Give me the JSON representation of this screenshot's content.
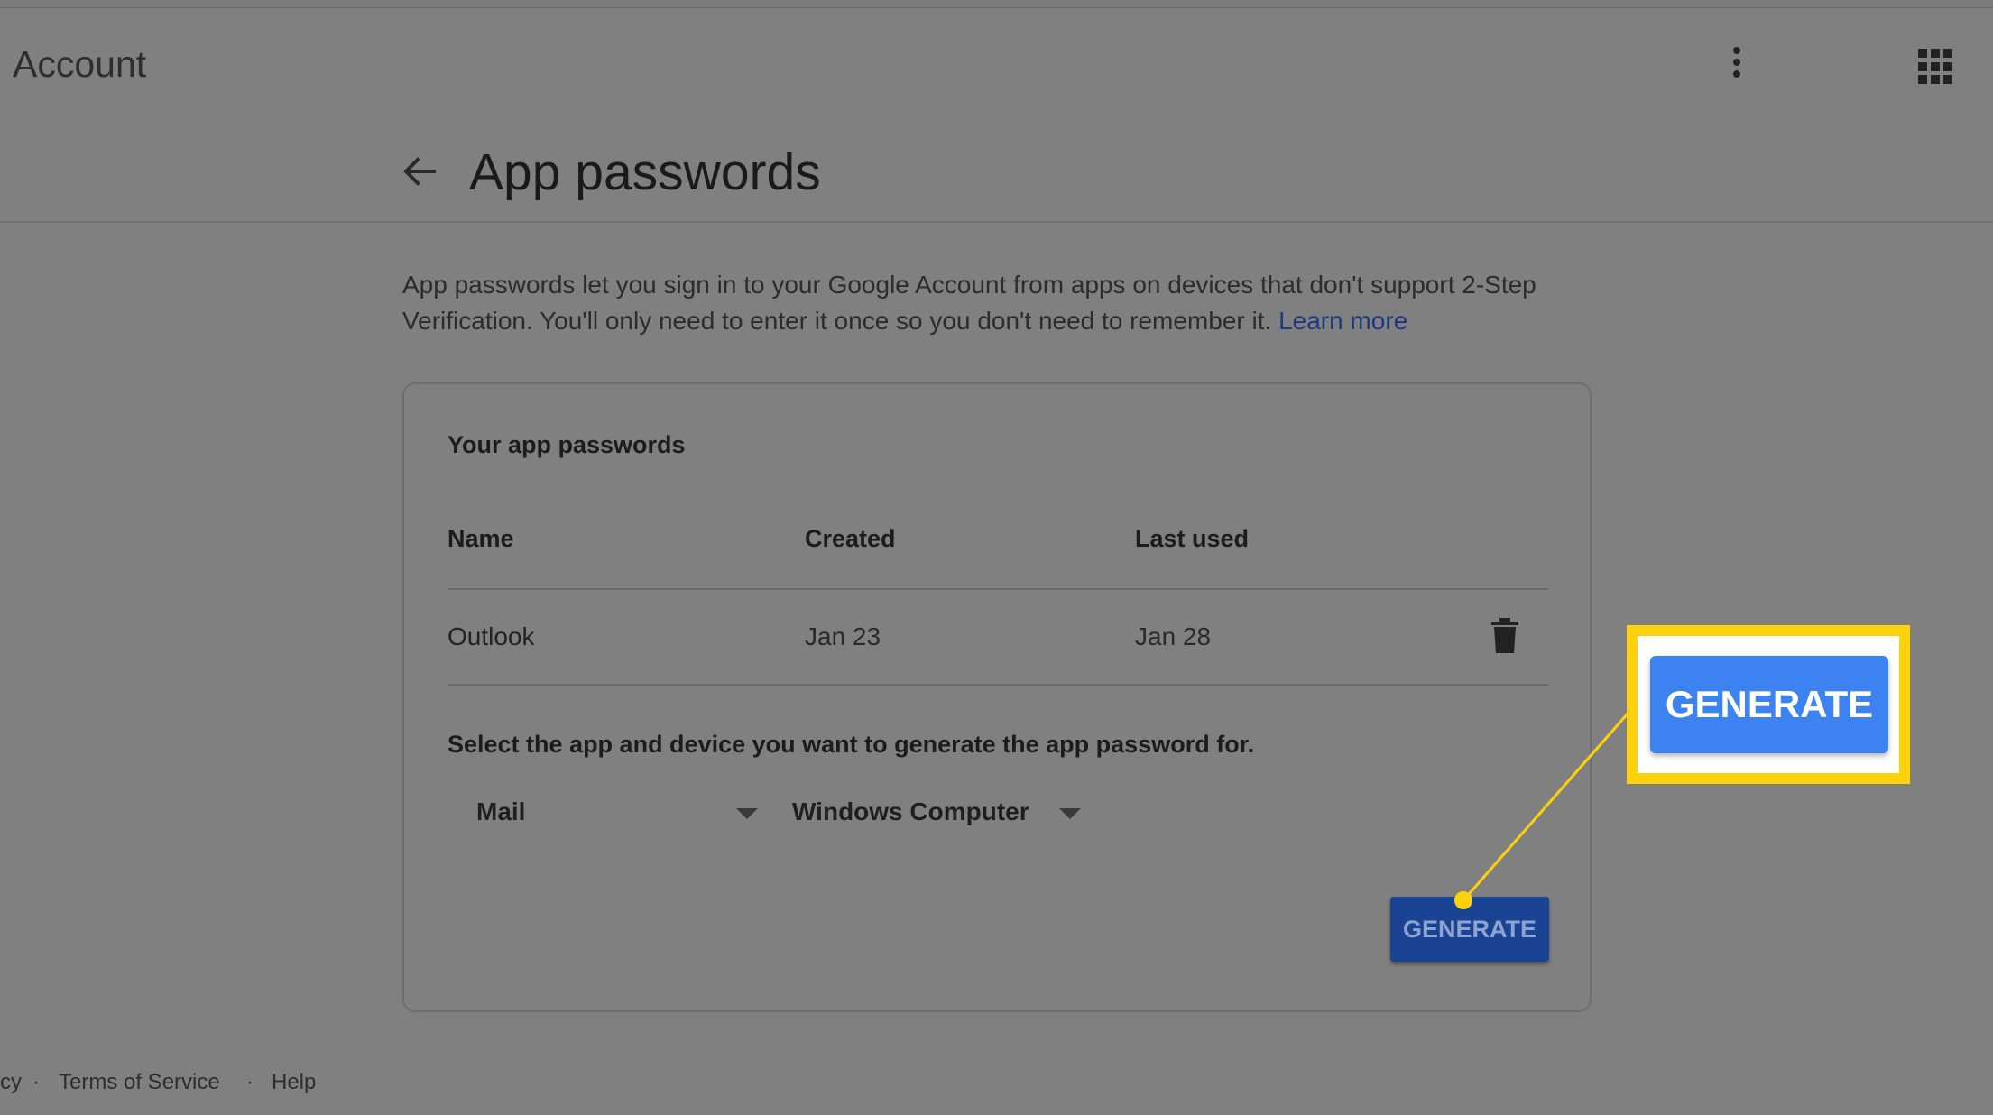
{
  "header": {
    "app_title": "Account",
    "more_icon": "more-vert-icon",
    "apps_icon": "apps-grid-icon"
  },
  "page": {
    "back_icon": "arrow-back-icon",
    "title": "App passwords",
    "description": "App passwords let you sign in to your Google Account from apps on devices that don't support 2-Step Verification. You'll only need to enter it once so you don't need to remember it.",
    "learn_more": "Learn more"
  },
  "card": {
    "title": "Your app passwords",
    "columns": {
      "name": "Name",
      "created": "Created",
      "last_used": "Last used"
    },
    "rows": [
      {
        "name": "Outlook",
        "created": "Jan 23",
        "last_used": "Jan 28",
        "action_icon": "trash-icon"
      }
    ],
    "select_prompt": "Select the app and device you want to generate the app password for.",
    "app_select": "Mail",
    "device_select": "Windows Computer",
    "generate_label": "GENERATE"
  },
  "footer": {
    "privacy": "cy",
    "separator": "·",
    "terms": "Terms of Service",
    "help": "Help"
  },
  "callout": {
    "label": "GENERATE",
    "color": "#fdd20a",
    "button_color": "#3c82f0"
  }
}
